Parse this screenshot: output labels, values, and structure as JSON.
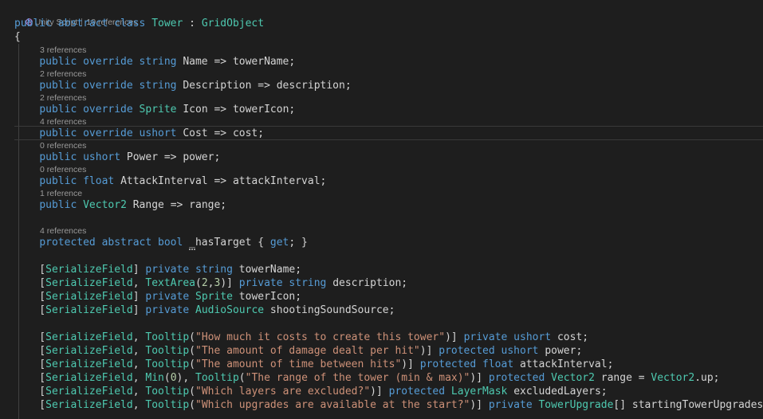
{
  "header_lens": {
    "unity_label": "Unity Script",
    "refs_label": "10 references"
  },
  "code_lines": [
    {
      "lens": null,
      "tokens": [
        [
          "kw",
          "public abstract class "
        ],
        [
          "ty",
          "Tower"
        ],
        [
          "pl",
          " : "
        ],
        [
          "ty",
          "GridObject"
        ]
      ]
    },
    {
      "lens": null,
      "tokens": [
        [
          "pl",
          "{"
        ]
      ]
    },
    {
      "lens": "3 references",
      "tokens": [
        [
          "pl",
          "    "
        ],
        [
          "kw",
          "public override string "
        ],
        [
          "pl",
          "Name => towerName;"
        ]
      ]
    },
    {
      "lens": "2 references",
      "tokens": [
        [
          "pl",
          "    "
        ],
        [
          "kw",
          "public override string "
        ],
        [
          "pl",
          "Description => description;"
        ]
      ]
    },
    {
      "lens": "2 references",
      "tokens": [
        [
          "pl",
          "    "
        ],
        [
          "kw",
          "public override "
        ],
        [
          "ty",
          "Sprite"
        ],
        [
          "pl",
          " Icon => towerIcon;"
        ]
      ]
    },
    {
      "lens": "4 references",
      "tokens": [
        [
          "pl",
          "    "
        ],
        [
          "kw",
          "public override ushort "
        ],
        [
          "pl",
          "Cost => cost;"
        ]
      ]
    },
    {
      "lens": "0 references",
      "tokens": [
        [
          "pl",
          "    "
        ],
        [
          "kw",
          "public ushort "
        ],
        [
          "pl",
          "Power => power;"
        ]
      ]
    },
    {
      "lens": "0 references",
      "tokens": [
        [
          "pl",
          "    "
        ],
        [
          "kw",
          "public float "
        ],
        [
          "pl",
          "AttackInterval => attackInterval;"
        ]
      ]
    },
    {
      "lens": "1 reference",
      "tokens": [
        [
          "pl",
          "    "
        ],
        [
          "kw",
          "public "
        ],
        [
          "ty",
          "Vector2"
        ],
        [
          "pl",
          " Range => range;"
        ]
      ]
    },
    {
      "lens": "4 references",
      "tokens": [
        [
          "pl",
          "    "
        ],
        [
          "kw",
          "protected abstract bool "
        ],
        [
          "pl",
          "_hasTarget { "
        ],
        [
          "kw",
          "get"
        ],
        [
          "pl",
          "; }"
        ]
      ]
    },
    {
      "lens": null,
      "tokens": [
        [
          "pl",
          "    ["
        ],
        [
          "ty",
          "SerializeField"
        ],
        [
          "pl",
          "] "
        ],
        [
          "kw",
          "private string "
        ],
        [
          "pl",
          "towerName;"
        ]
      ]
    },
    {
      "lens": null,
      "tokens": [
        [
          "pl",
          "    ["
        ],
        [
          "ty",
          "SerializeField"
        ],
        [
          "pl",
          ", "
        ],
        [
          "ty",
          "TextArea"
        ],
        [
          "pl",
          "("
        ],
        [
          "nm",
          "2"
        ],
        [
          "pl",
          ","
        ],
        [
          "nm",
          "3"
        ],
        [
          "pl",
          ")] "
        ],
        [
          "kw",
          "private string "
        ],
        [
          "pl",
          "description;"
        ]
      ]
    },
    {
      "lens": null,
      "tokens": [
        [
          "pl",
          "    ["
        ],
        [
          "ty",
          "SerializeField"
        ],
        [
          "pl",
          "] "
        ],
        [
          "kw",
          "private "
        ],
        [
          "ty",
          "Sprite"
        ],
        [
          "pl",
          " towerIcon;"
        ]
      ]
    },
    {
      "lens": null,
      "tokens": [
        [
          "pl",
          "    ["
        ],
        [
          "ty",
          "SerializeField"
        ],
        [
          "pl",
          "] "
        ],
        [
          "kw",
          "private "
        ],
        [
          "ty",
          "AudioSource"
        ],
        [
          "pl",
          " shootingSoundSource;"
        ]
      ]
    },
    {
      "lens": null,
      "tokens": [
        [
          "pl",
          "    ["
        ],
        [
          "ty",
          "SerializeField"
        ],
        [
          "pl",
          ", "
        ],
        [
          "ty",
          "Tooltip"
        ],
        [
          "pl",
          "("
        ],
        [
          "st",
          "\"How much it costs to create this tower\""
        ],
        [
          "pl",
          ")] "
        ],
        [
          "kw",
          "private ushort "
        ],
        [
          "pl",
          "cost;"
        ]
      ]
    },
    {
      "lens": null,
      "tokens": [
        [
          "pl",
          "    ["
        ],
        [
          "ty",
          "SerializeField"
        ],
        [
          "pl",
          ", "
        ],
        [
          "ty",
          "Tooltip"
        ],
        [
          "pl",
          "("
        ],
        [
          "st",
          "\"The amount of damage dealt per hit\""
        ],
        [
          "pl",
          ")] "
        ],
        [
          "kw",
          "protected ushort "
        ],
        [
          "pl",
          "power;"
        ]
      ]
    },
    {
      "lens": null,
      "tokens": [
        [
          "pl",
          "    ["
        ],
        [
          "ty",
          "SerializeField"
        ],
        [
          "pl",
          ", "
        ],
        [
          "ty",
          "Tooltip"
        ],
        [
          "pl",
          "("
        ],
        [
          "st",
          "\"The amount of time between hits\""
        ],
        [
          "pl",
          ")] "
        ],
        [
          "kw",
          "protected float "
        ],
        [
          "pl",
          "attackInterval;"
        ]
      ]
    },
    {
      "lens": null,
      "tokens": [
        [
          "pl",
          "    ["
        ],
        [
          "ty",
          "SerializeField"
        ],
        [
          "pl",
          ", "
        ],
        [
          "ty",
          "Min"
        ],
        [
          "pl",
          "("
        ],
        [
          "nm",
          "0"
        ],
        [
          "pl",
          "), "
        ],
        [
          "ty",
          "Tooltip"
        ],
        [
          "pl",
          "("
        ],
        [
          "st",
          "\"The range of the tower (min & max)\""
        ],
        [
          "pl",
          ")] "
        ],
        [
          "kw",
          "protected "
        ],
        [
          "ty",
          "Vector2"
        ],
        [
          "pl",
          " range = "
        ],
        [
          "ty",
          "Vector2"
        ],
        [
          "pl",
          ".up;"
        ]
      ]
    },
    {
      "lens": null,
      "tokens": [
        [
          "pl",
          "    ["
        ],
        [
          "ty",
          "SerializeField"
        ],
        [
          "pl",
          ", "
        ],
        [
          "ty",
          "Tooltip"
        ],
        [
          "pl",
          "("
        ],
        [
          "st",
          "\"Which layers are excluded?\""
        ],
        [
          "pl",
          ")] "
        ],
        [
          "kw",
          "protected "
        ],
        [
          "ty",
          "LayerMask"
        ],
        [
          "pl",
          " excludedLayers;"
        ]
      ]
    },
    {
      "lens": null,
      "tokens": [
        [
          "pl",
          "    ["
        ],
        [
          "ty",
          "SerializeField"
        ],
        [
          "pl",
          ", "
        ],
        [
          "ty",
          "Tooltip"
        ],
        [
          "pl",
          "("
        ],
        [
          "st",
          "\"Which upgrades are available at the start?\""
        ],
        [
          "pl",
          ")] "
        ],
        [
          "kw",
          "private "
        ],
        [
          "ty",
          "TowerUpgrade"
        ],
        [
          "pl",
          "[] startingTowerUpgrades;"
        ]
      ]
    }
  ],
  "colors": {
    "background": "#1e1e1e",
    "keyword": "#569cd6",
    "type": "#4ec9b0",
    "string": "#ce9178",
    "number": "#b5cea8",
    "plain": "#d4d4d4",
    "codelens": "#9a9a9a"
  },
  "icons": {
    "unity": "unity-script-icon"
  }
}
